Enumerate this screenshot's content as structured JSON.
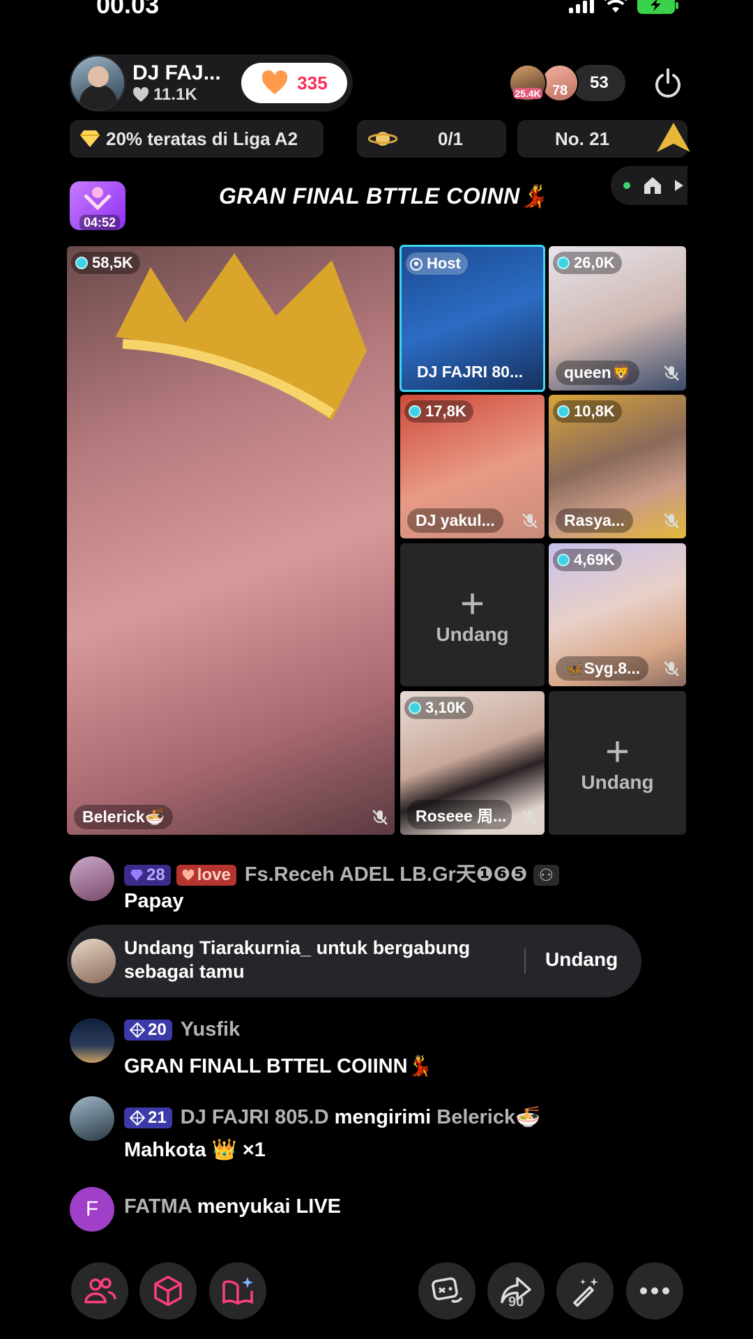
{
  "status_bar": {
    "time": "00.03"
  },
  "host": {
    "name": "DJ FAJ...",
    "likes": "11.1K",
    "follow_count": "335"
  },
  "viewers": {
    "avatar1_badge": "25.4K",
    "avatar2_badge": "78",
    "count": "53"
  },
  "info": {
    "league": "20% teratas di Liga A2",
    "match": "0/1",
    "rank": "No. 21"
  },
  "battle": {
    "timer": "04:52",
    "title": "GRAN FINAL BTTLE COINN💃"
  },
  "tiles": {
    "main": {
      "score": "58,5K",
      "name": "Belerick🍜"
    },
    "host": {
      "badge": "Host",
      "name": "DJ FAJRI 80..."
    },
    "queen": {
      "score": "26,0K",
      "name": "queen🦁"
    },
    "yakul": {
      "score": "17,8K",
      "name": "DJ yakul..."
    },
    "rasya": {
      "score": "10,8K",
      "name": "Rasya..."
    },
    "invite1": {
      "label": "Undang"
    },
    "syg": {
      "score": "4,69K",
      "name": "🦋Syg.8..."
    },
    "roseee": {
      "score": "3,10K",
      "name": "Roseee 周..."
    },
    "invite2": {
      "label": "Undang"
    }
  },
  "chat": {
    "msg1": {
      "level": "28",
      "fan_badge": "love",
      "name": "Fs.Receh ADEL LB.Gr天❶❻❺",
      "text": "Papay"
    },
    "invite": {
      "text_line1": "Undang Tiarakurnia_ untuk bergabung",
      "text_line2": "sebagai tamu",
      "button": "Undang"
    },
    "msg2": {
      "level": "20",
      "name": "Yusfik",
      "text": "GRAN FINALL BTTEL COIINN💃"
    },
    "msg3": {
      "level": "21",
      "name": "DJ FAJRI 805.D",
      "action": "mengirimi",
      "target": "Belerick🍜",
      "gift": "Mahkota 👑 ×1"
    },
    "msg4": {
      "avatar_letter": "F",
      "name": "FATMA",
      "action": "menyukai LIVE"
    }
  },
  "bottom_bar": {
    "share_count": "90"
  },
  "colors": {
    "accent_pink": "#fe2c55",
    "host_tile_border": "#3fd6f0",
    "invite_bg": "#262628",
    "fatma_avatar": "#a040c8"
  }
}
